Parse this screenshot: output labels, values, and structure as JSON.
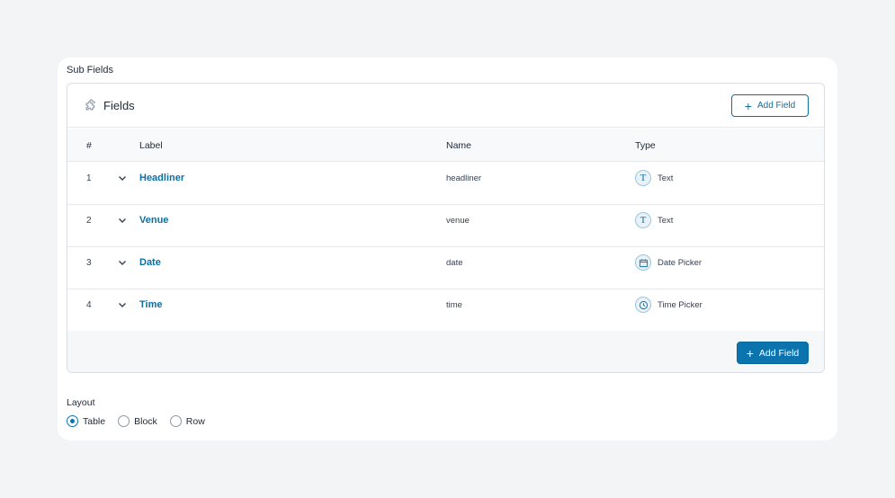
{
  "section_label": "Sub Fields",
  "fields_panel": {
    "title": "Fields",
    "icon": "puzzle-icon",
    "add_button_top": "Add Field",
    "add_button_bottom": "Add Field",
    "columns": {
      "num": "#",
      "label": "Label",
      "name": "Name",
      "type": "Type"
    },
    "rows": [
      {
        "num": "1",
        "label": "Headliner",
        "name": "headliner",
        "type": "Text",
        "type_icon": "text-type-icon"
      },
      {
        "num": "2",
        "label": "Venue",
        "name": "venue",
        "type": "Text",
        "type_icon": "text-type-icon"
      },
      {
        "num": "3",
        "label": "Date",
        "name": "date",
        "type": "Date Picker",
        "type_icon": "calendar-icon"
      },
      {
        "num": "4",
        "label": "Time",
        "name": "time",
        "type": "Time Picker",
        "type_icon": "clock-icon"
      }
    ]
  },
  "layout": {
    "label": "Layout",
    "options": [
      {
        "label": "Table",
        "checked": true
      },
      {
        "label": "Block",
        "checked": false
      },
      {
        "label": "Row",
        "checked": false
      }
    ]
  },
  "colors": {
    "accent": "#0b73ad",
    "page_bg": "#f3f4f6",
    "card_bg": "#ffffff"
  }
}
